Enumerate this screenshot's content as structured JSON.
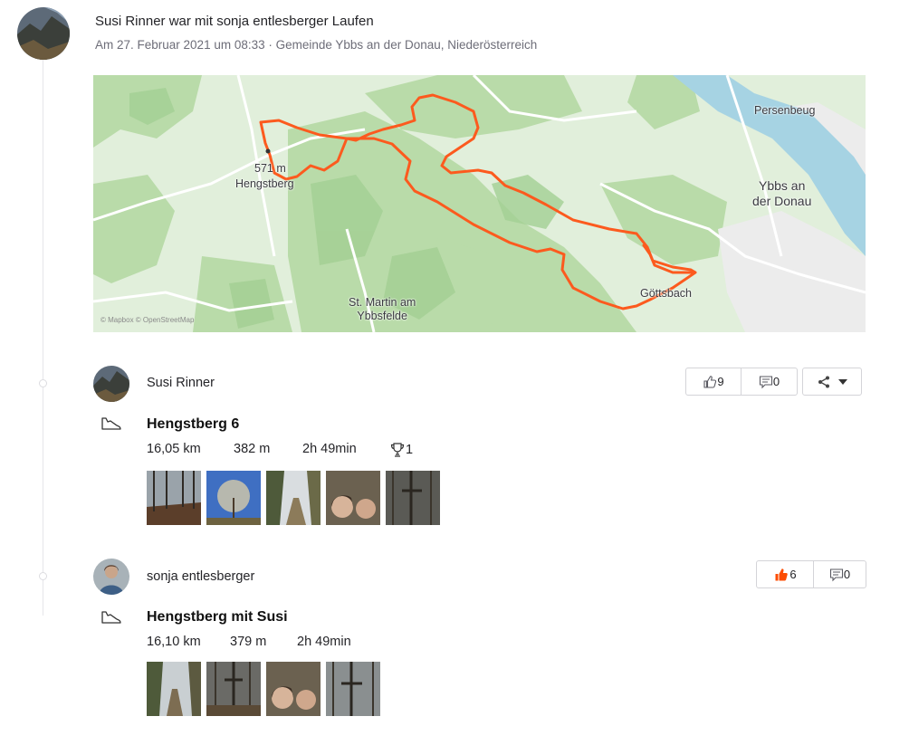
{
  "group": {
    "title": "Susi Rinner war mit sonja entlesberger Laufen",
    "subtitle": "Am 27. Februar 2021 um 08:33 · Gemeinde Ybbs an der Donau, Niederösterreich"
  },
  "map": {
    "labels": {
      "persenbeug": "Persenbeug",
      "ybbs_line1": "Ybbs an",
      "ybbs_line2": "der Donau",
      "elevation": "571 m",
      "hengstberg": "Hengstberg",
      "st_martin_line1": "St. Martin am",
      "st_martin_line2": "Ybbsfelde",
      "goettsbach": "Göttsbach",
      "attribution": "© Mapbox © OpenStreetMap"
    },
    "colors": {
      "route": "#fc5a1e",
      "forest": "#b9dba9",
      "water": "#a6d3e3",
      "land": "#e1efdb"
    }
  },
  "activities": [
    {
      "athlete": "Susi Rinner",
      "title": "Hengstberg 6",
      "distance": "16,05 km",
      "elevation": "382 m",
      "time": "2h 49min",
      "achievements": "1",
      "kudos": "9",
      "comments": "0",
      "kudos_given": false
    },
    {
      "athlete": "sonja entlesberger",
      "title": "Hengstberg mit Susi",
      "distance": "16,10 km",
      "elevation": "379 m",
      "time": "2h 49min",
      "kudos": "6",
      "comments": "0",
      "kudos_given": true
    }
  ],
  "colors": {
    "brand": "#fc4c02",
    "text": "#242428",
    "muted": "#6d6d78",
    "border": "#d4d4d8"
  },
  "icons": [
    "shoe-icon",
    "thumbs-up-icon",
    "comment-icon",
    "share-icon",
    "caret-down-icon",
    "trophy-icon"
  ]
}
